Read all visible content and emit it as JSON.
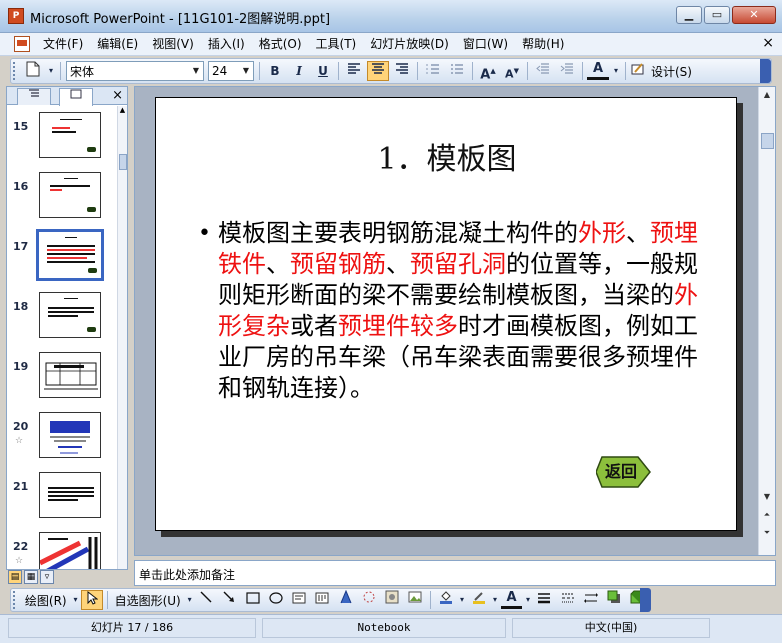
{
  "window": {
    "title": "Microsoft PowerPoint - [11G101-2图解说明.ppt]",
    "app_icon": "powerpoint-icon",
    "buttons": [
      "minimize",
      "maximize",
      "close"
    ]
  },
  "menu": {
    "items": [
      "文件(F)",
      "编辑(E)",
      "视图(V)",
      "插入(I)",
      "格式(O)",
      "工具(T)",
      "幻灯片放映(D)",
      "窗口(W)",
      "帮助(H)"
    ],
    "close_glyph": "×"
  },
  "format_toolbar": {
    "font": "宋体",
    "size": "24",
    "bold": "B",
    "italic": "I",
    "underline": "U",
    "font_color": "A",
    "design_label": "设计(S)"
  },
  "left_panel": {
    "tabs": [
      "outline-tab",
      "slides-tab"
    ],
    "close_glyph": "×",
    "slides": [
      {
        "num": "15",
        "star": ""
      },
      {
        "num": "16",
        "star": ""
      },
      {
        "num": "17",
        "star": "",
        "selected": true
      },
      {
        "num": "18",
        "star": ""
      },
      {
        "num": "19",
        "star": ""
      },
      {
        "num": "20",
        "star": "☆"
      },
      {
        "num": "21",
        "star": ""
      },
      {
        "num": "22",
        "star": "☆"
      }
    ]
  },
  "slide": {
    "title": "1．模板图",
    "body_segments": [
      {
        "text": "模板图主要表明钢筋混凝土构件的",
        "red": false
      },
      {
        "text": "外形",
        "red": true
      },
      {
        "text": "、",
        "red": false
      },
      {
        "text": "预埋铁件",
        "red": true
      },
      {
        "text": "、",
        "red": false
      },
      {
        "text": "预留钢筋",
        "red": true
      },
      {
        "text": "、",
        "red": false
      },
      {
        "text": "预留孔洞",
        "red": true
      },
      {
        "text": "的位置等，一般规则矩形断面的梁不需要绘制模板图，当梁的",
        "red": false
      },
      {
        "text": "外形复杂",
        "red": true
      },
      {
        "text": "或者",
        "red": false
      },
      {
        "text": "预埋件较多",
        "red": true
      },
      {
        "text": "时才画模板图，例如工业厂房的吊车梁（吊车梁表面需要很多预埋件和钢轨连接）。",
        "red": false
      }
    ],
    "return_button": "返回",
    "accent_red": "#ee1111",
    "return_fill": "#8cbf3c"
  },
  "notes": {
    "placeholder": "单击此处添加备注"
  },
  "drawing_toolbar": {
    "draw_label": "绘图(R)",
    "autoshape_label": "自选图形(U)"
  },
  "status": {
    "slide_info": "幻灯片 17 / 186",
    "template": "Notebook",
    "language": "中文(中国)"
  }
}
